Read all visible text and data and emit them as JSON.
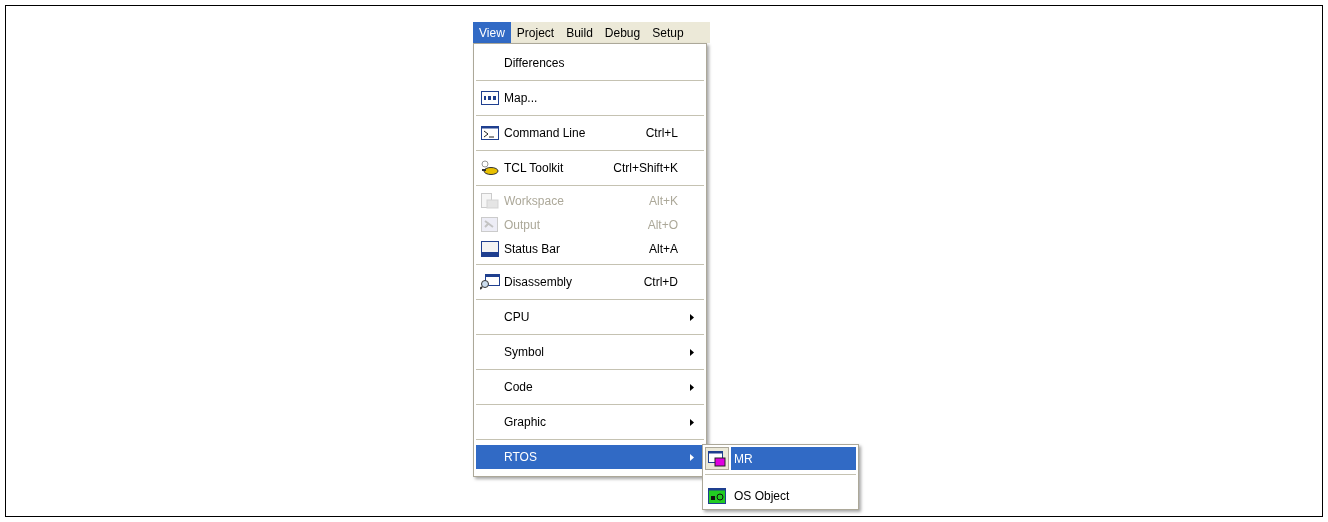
{
  "menu_bar": [
    {
      "label": "View",
      "selected": true
    },
    {
      "label": "Project",
      "selected": false
    },
    {
      "label": "Build",
      "selected": false
    },
    {
      "label": "Debug",
      "selected": false
    },
    {
      "label": "Setup",
      "selected": false
    }
  ],
  "menu_groups": [
    [
      {
        "label": "Differences",
        "disabled": false,
        "selected": false,
        "submenu": false
      }
    ],
    [
      {
        "label": "Map...",
        "disabled": false,
        "selected": false,
        "submenu": false
      }
    ],
    [
      {
        "label": "Command Line",
        "shortcut": "Ctrl+L",
        "disabled": false,
        "selected": false,
        "submenu": false
      }
    ],
    [
      {
        "label": "TCL Toolkit",
        "shortcut": "Ctrl+Shift+K",
        "disabled": false,
        "selected": false,
        "submenu": false
      }
    ],
    [
      {
        "label": "Workspace",
        "shortcut": "Alt+K",
        "disabled": true,
        "selected": false,
        "submenu": false
      },
      {
        "label": "Output",
        "shortcut": "Alt+O",
        "disabled": true,
        "selected": false,
        "submenu": false
      },
      {
        "label": "Status Bar",
        "shortcut": "Alt+A",
        "disabled": false,
        "selected": false,
        "submenu": false
      }
    ],
    [
      {
        "label": "Disassembly",
        "shortcut": "Ctrl+D",
        "disabled": false,
        "selected": false,
        "submenu": false
      }
    ],
    [
      {
        "label": "CPU",
        "disabled": false,
        "selected": false,
        "submenu": true
      }
    ],
    [
      {
        "label": "Symbol",
        "disabled": false,
        "selected": false,
        "submenu": true
      }
    ],
    [
      {
        "label": "Code",
        "disabled": false,
        "selected": false,
        "submenu": true
      }
    ],
    [
      {
        "label": "Graphic",
        "disabled": false,
        "selected": false,
        "submenu": true
      }
    ],
    [
      {
        "label": "RTOS",
        "disabled": false,
        "selected": true,
        "submenu": true
      }
    ]
  ],
  "submenu": [
    {
      "label": "MR",
      "selected": true
    },
    {
      "label": "OS Object",
      "selected": false
    }
  ]
}
